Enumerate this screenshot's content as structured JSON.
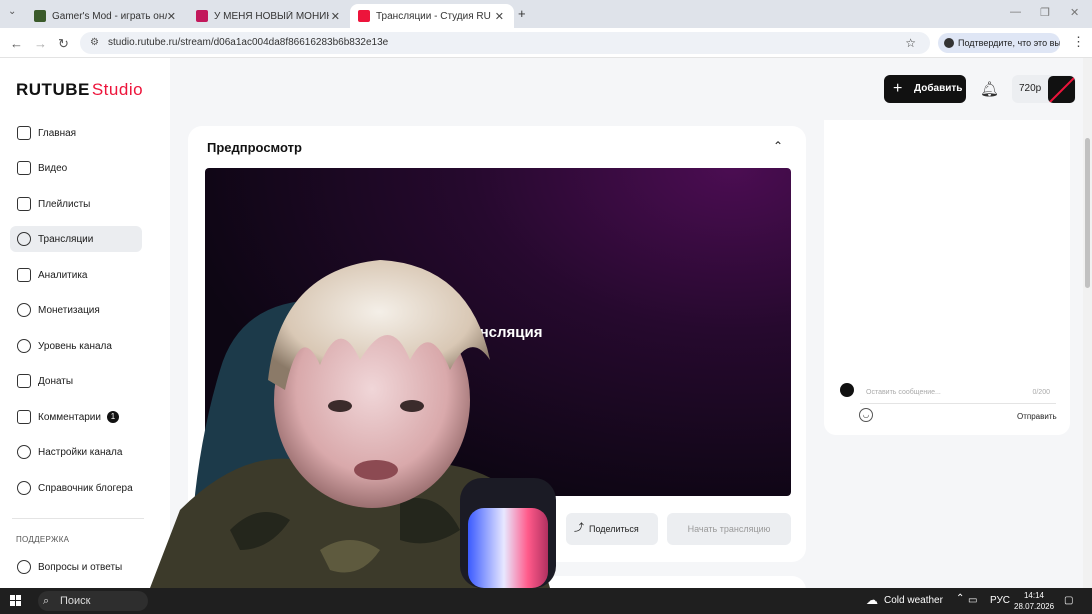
{
  "browser": {
    "tabs": [
      {
        "title": "Gamer's Mod - играть онлайн",
        "favicon_color": "#3a5a2a"
      },
      {
        "title": "У МЕНЯ НОВЫЙ МОНИК!! СТРИМ",
        "favicon_color": "#c2185b"
      },
      {
        "title": "Трансляции - Студия RUTUBE",
        "favicon_color": "#ed143b"
      }
    ],
    "new_tab": "+",
    "close": "✕",
    "url": "studio.rutube.ru/stream/d06a1ac004da8f86616283b6b832e13e",
    "confirm_prompt": "Подтвердите, что это вы"
  },
  "app": {
    "logo_main": "RUTUBE",
    "logo_studio": "Studio",
    "accent_color": "#ed143b",
    "sidebar": {
      "items": [
        {
          "label": "Главная",
          "icon": "home-icon"
        },
        {
          "label": "Видео",
          "icon": "video-icon"
        },
        {
          "label": "Плейлисты",
          "icon": "playlist-icon"
        },
        {
          "label": "Трансляции",
          "icon": "broadcast-icon",
          "active": true
        },
        {
          "label": "Аналитика",
          "icon": "analytics-icon"
        },
        {
          "label": "Монетизация",
          "icon": "monetization-icon"
        },
        {
          "label": "Уровень канала",
          "icon": "star-icon"
        },
        {
          "label": "Донаты",
          "icon": "donate-icon"
        },
        {
          "label": "Комментарии",
          "icon": "comments-icon",
          "badge": "1"
        },
        {
          "label": "Настройки канала",
          "icon": "gear-icon"
        },
        {
          "label": "Справочник блогера",
          "icon": "info-icon"
        }
      ],
      "support_heading": "ПОДДЕРЖКА",
      "support_items": [
        {
          "label": "Вопросы и ответы",
          "icon": "help-icon"
        }
      ]
    },
    "header": {
      "add_label": "Добавить",
      "quality_label": "720р"
    },
    "preview": {
      "title": "Предпросмотр",
      "player_text": "Трансляция",
      "share_label": "Поделиться",
      "start_label": "Начать трансляцию"
    },
    "chat": {
      "placeholder": "Оставить сообщение...",
      "count": "0/200",
      "send_label": "Отправить"
    }
  },
  "taskbar": {
    "search_label": "Поиск",
    "weather": "Cold weather",
    "language": "РУС",
    "time": "14:14",
    "date": "28.07.2026"
  }
}
